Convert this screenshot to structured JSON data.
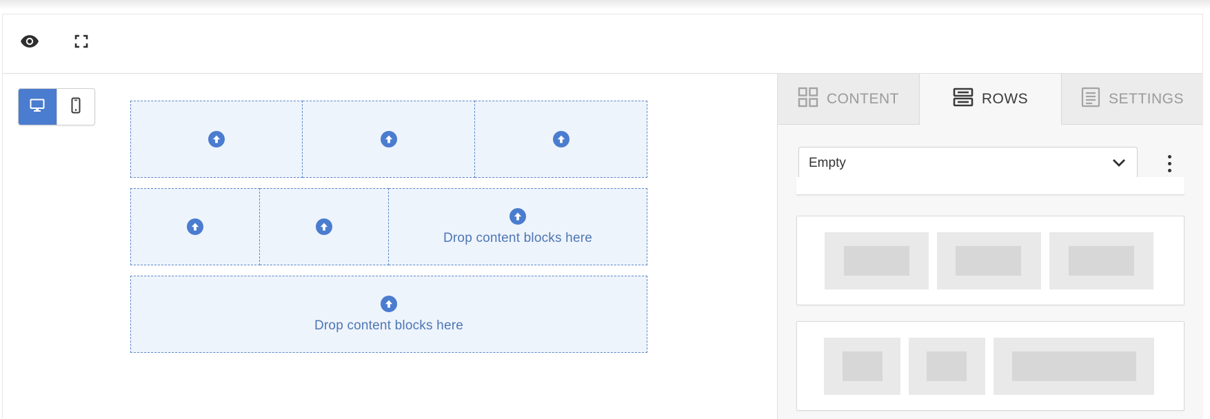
{
  "toolbar": {
    "preview_icon": "eye-icon",
    "fullscreen_icon": "fullscreen-icon"
  },
  "device_toggle": {
    "desktop_icon": "desktop-icon",
    "mobile_icon": "mobile-icon",
    "active": "desktop"
  },
  "canvas": {
    "drop_text": "Drop content blocks here",
    "rows": [
      {
        "cells": [
          {
            "icon": "upload-icon",
            "text": ""
          },
          {
            "icon": "upload-icon",
            "text": ""
          },
          {
            "icon": "upload-icon",
            "text": ""
          }
        ]
      },
      {
        "cells": [
          {
            "icon": "upload-icon",
            "text": ""
          },
          {
            "icon": "upload-icon",
            "text": ""
          },
          {
            "icon": "upload-icon",
            "text": "Drop content blocks here"
          }
        ]
      },
      {
        "cells": [
          {
            "icon": "upload-icon",
            "text": "Drop content blocks here"
          }
        ]
      }
    ]
  },
  "panel": {
    "tabs": [
      {
        "label": "CONTENT",
        "icon": "grid-icon",
        "active": false
      },
      {
        "label": "ROWS",
        "icon": "rows-icon",
        "active": true
      },
      {
        "label": "SETTINGS",
        "icon": "document-icon",
        "active": false
      }
    ],
    "row_select": {
      "value": "Empty"
    },
    "menu_icon": "more-vertical-icon"
  },
  "colors": {
    "accent": "#4a7ccf",
    "drop_zone_bg": "#eef4fc",
    "drop_zone_border": "#5c86c8",
    "drop_text": "#4d76b4",
    "panel_bg": "#f7f7f7",
    "placeholder": "#e9e9e9",
    "placeholder_inner": "#d7d7d7"
  }
}
